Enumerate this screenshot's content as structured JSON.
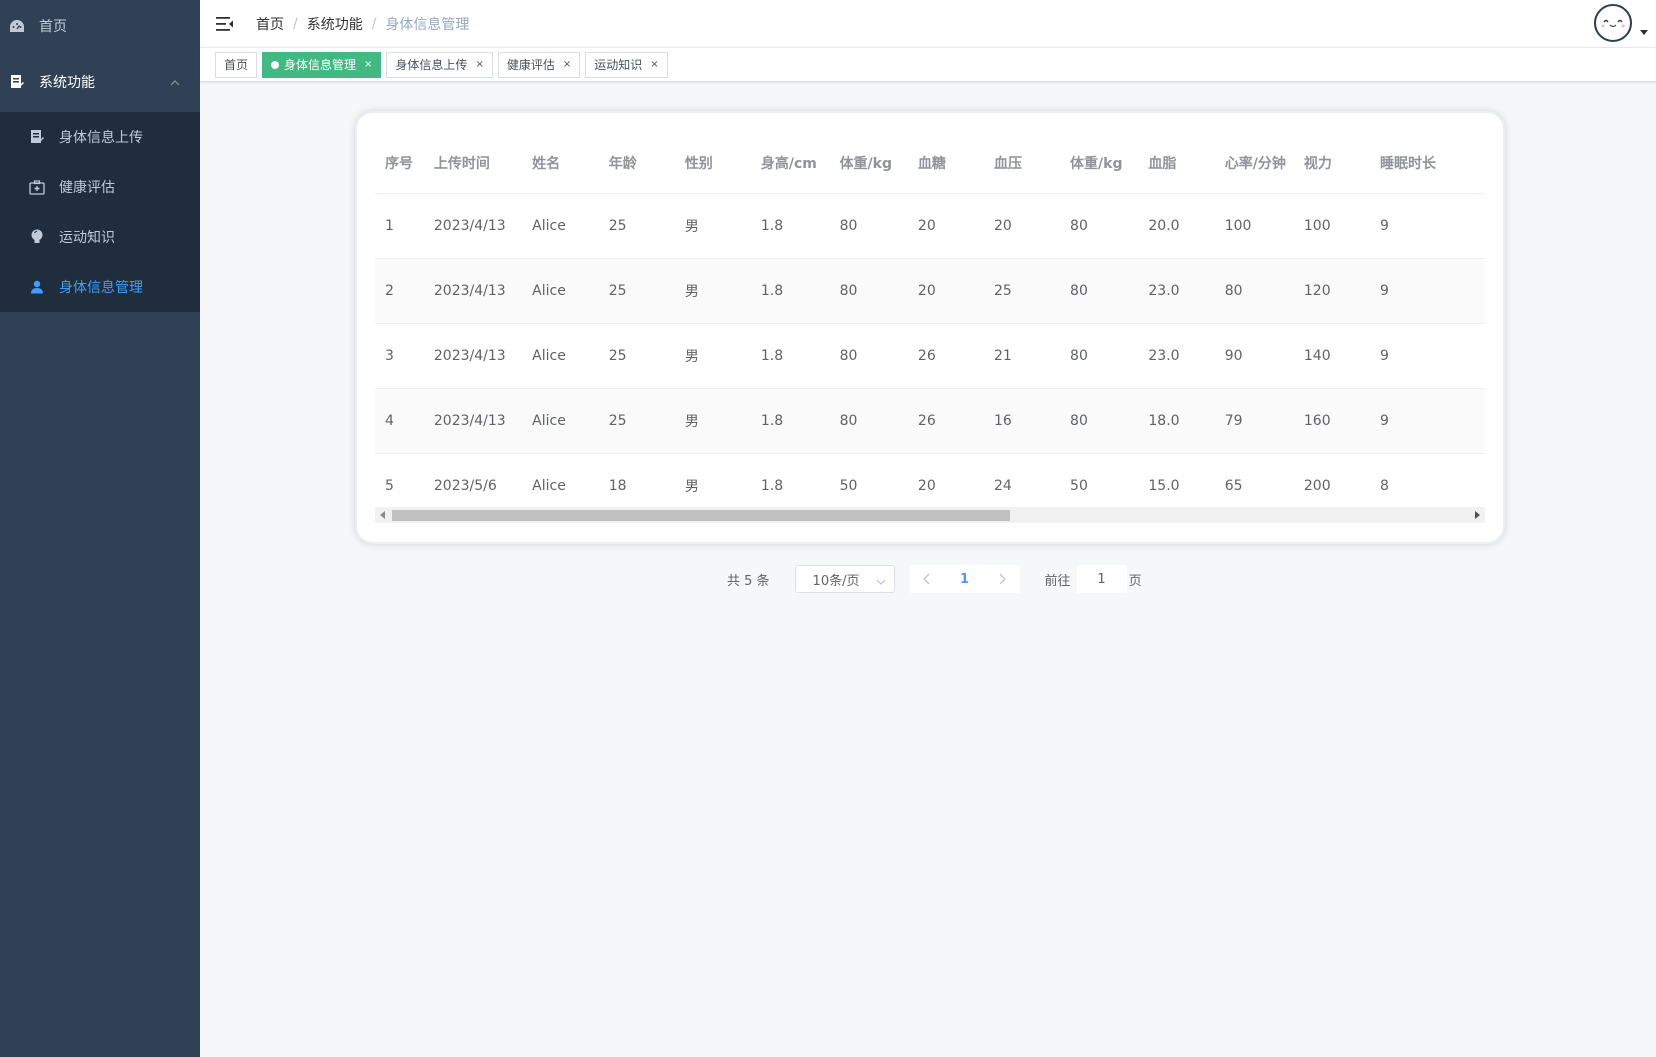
{
  "sidebar": {
    "home": "首页",
    "group": "系统功能",
    "items": [
      {
        "label": "身体信息上传",
        "icon": "document-icon"
      },
      {
        "label": "健康评估",
        "icon": "medical-kit-icon"
      },
      {
        "label": "运动知识",
        "icon": "lightbulb-icon"
      },
      {
        "label": "身体信息管理",
        "icon": "user-icon",
        "active": true
      }
    ]
  },
  "breadcrumb": [
    "首页",
    "系统功能",
    "身体信息管理"
  ],
  "tags": [
    {
      "label": "首页"
    },
    {
      "label": "身体信息管理",
      "active": true
    },
    {
      "label": "身体信息上传"
    },
    {
      "label": "健康评估"
    },
    {
      "label": "运动知识"
    }
  ],
  "table": {
    "columns": [
      "序号",
      "上传时间",
      "姓名",
      "年龄",
      "性别",
      "身高/cm",
      "体重/kg",
      "血糖",
      "血压",
      "体重/kg",
      "血脂",
      "心率/分钟",
      "视力",
      "睡眠时长"
    ],
    "rows": [
      [
        "1",
        "2023/4/13",
        "Alice",
        "25",
        "男",
        "1.8",
        "80",
        "20",
        "20",
        "80",
        "20.0",
        "100",
        "100",
        "9"
      ],
      [
        "2",
        "2023/4/13",
        "Alice",
        "25",
        "男",
        "1.8",
        "80",
        "20",
        "25",
        "80",
        "23.0",
        "80",
        "120",
        "9"
      ],
      [
        "3",
        "2023/4/13",
        "Alice",
        "25",
        "男",
        "1.8",
        "80",
        "26",
        "21",
        "80",
        "23.0",
        "90",
        "140",
        "9"
      ],
      [
        "4",
        "2023/4/13",
        "Alice",
        "25",
        "男",
        "1.8",
        "80",
        "26",
        "16",
        "80",
        "18.0",
        "79",
        "160",
        "9"
      ],
      [
        "5",
        "2023/5/6",
        "Alice",
        "18",
        "男",
        "1.8",
        "50",
        "20",
        "24",
        "50",
        "15.0",
        "65",
        "200",
        "8"
      ]
    ]
  },
  "pagination": {
    "total": "共 5 条",
    "page_size": "10条/页",
    "current_page": "1",
    "goto_label": "前往",
    "goto_value": "1",
    "page_unit": "页"
  },
  "colors": {
    "sidebar_bg": "#304156",
    "submenu_bg": "#1f2d3d",
    "active_menu": "#409eff",
    "active_tag": "#42b983"
  }
}
